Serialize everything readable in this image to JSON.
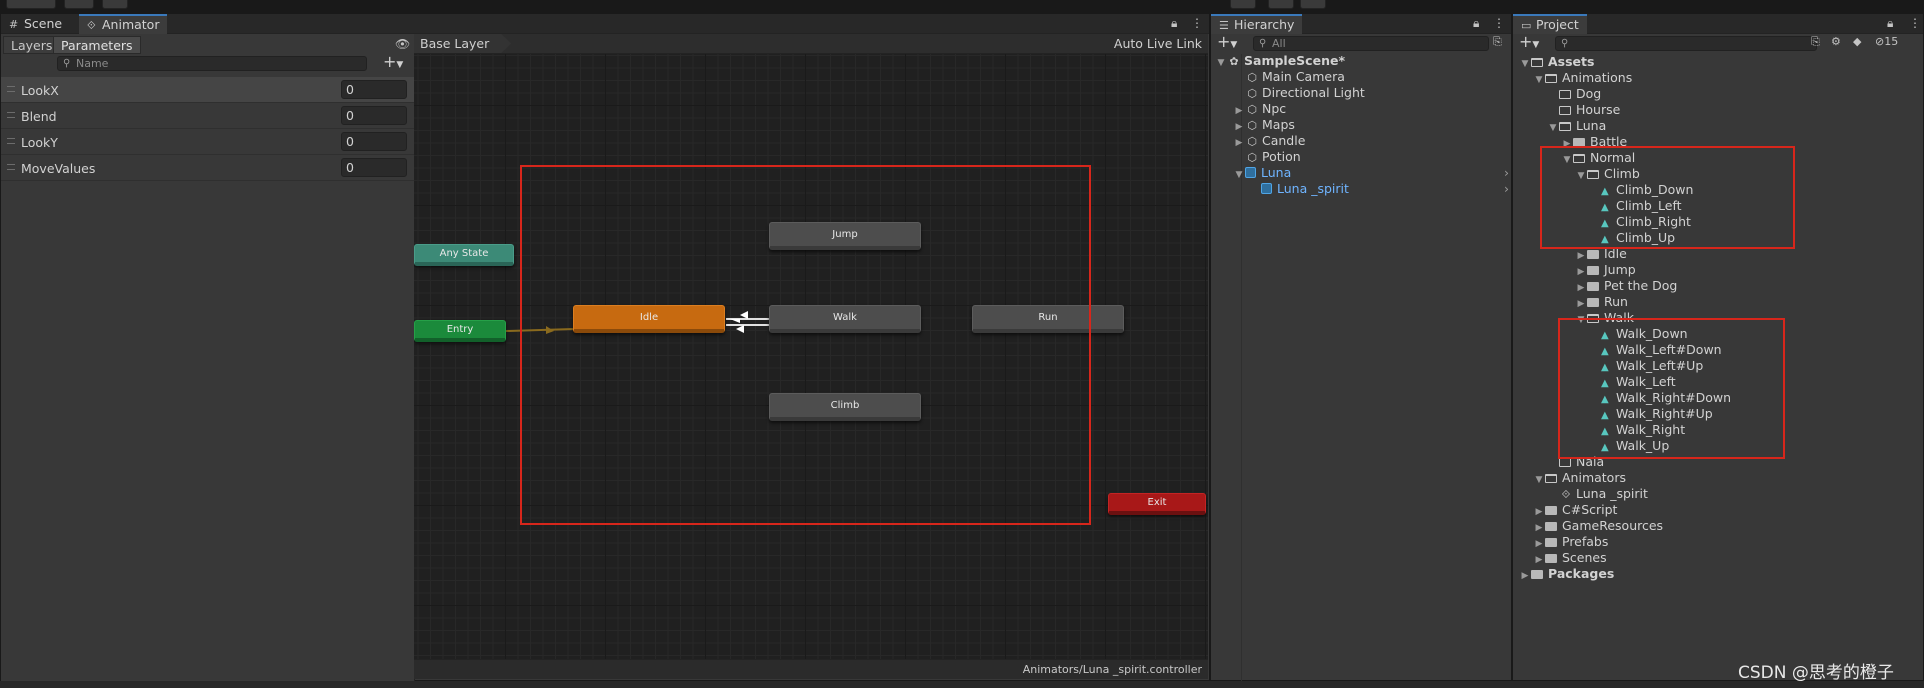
{
  "animator_window": {
    "tabs": [
      {
        "label": "Scene",
        "icon": "grid-icon"
      },
      {
        "label": "Animator",
        "icon": "animator-icon"
      }
    ],
    "left_pane": {
      "segments": [
        "Layers",
        "Parameters"
      ],
      "active_segment": "Parameters",
      "search_placeholder": "Name",
      "add_symbol": "+",
      "parameters": [
        {
          "name": "LookX",
          "value": "0"
        },
        {
          "name": "Blend",
          "value": "0"
        },
        {
          "name": "LookY",
          "value": "0"
        },
        {
          "name": "MoveValues",
          "value": "0"
        }
      ]
    },
    "graph": {
      "breadcrumb": "Base Layer",
      "live_link_label": "Auto Live Link",
      "states": {
        "any_state": "Any State",
        "entry": "Entry",
        "idle": "Idle",
        "jump": "Jump",
        "walk": "Walk",
        "run": "Run",
        "climb": "Climb",
        "exit": "Exit"
      },
      "status_path": "Animators/Luna _spirit.controller"
    }
  },
  "hierarchy_window": {
    "tab_label": "Hierarchy",
    "search_placeholder": "All",
    "scene_name": "SampleScene*",
    "items": [
      {
        "label": "Main Camera",
        "icon": "gameobject-icon",
        "expandable": false
      },
      {
        "label": "Directional Light",
        "icon": "gameobject-icon",
        "expandable": false
      },
      {
        "label": "Npc",
        "icon": "gameobject-icon",
        "expandable": true
      },
      {
        "label": "Maps",
        "icon": "gameobject-icon",
        "expandable": true
      },
      {
        "label": "Candle",
        "icon": "gameobject-icon",
        "expandable": true
      },
      {
        "label": "Potion",
        "icon": "gameobject-icon",
        "expandable": false
      },
      {
        "label": "Luna",
        "icon": "prefab-icon",
        "expandable": true,
        "expanded": true
      },
      {
        "label": "Luna _spirit",
        "icon": "prefab-icon",
        "expandable": false
      }
    ]
  },
  "project_window": {
    "tab_label": "Project",
    "hidden_count": "15",
    "tree": [
      {
        "label": "Assets",
        "bold": true
      },
      {
        "label": "Animations"
      },
      {
        "label": "Dog"
      },
      {
        "label": "Hourse"
      },
      {
        "label": "Luna"
      },
      {
        "label": "Battle"
      },
      {
        "label": "Normal"
      },
      {
        "label": "Climb"
      },
      {
        "label": "Climb_Down"
      },
      {
        "label": "Climb_Left"
      },
      {
        "label": "Climb_Right"
      },
      {
        "label": "Climb_Up"
      },
      {
        "label": "Idle"
      },
      {
        "label": "Jump"
      },
      {
        "label": "Pet the Dog"
      },
      {
        "label": "Run"
      },
      {
        "label": "Walk"
      },
      {
        "label": "Walk_Down"
      },
      {
        "label": "Walk_Left#Down"
      },
      {
        "label": "Walk_Left#Up"
      },
      {
        "label": "Walk_Left"
      },
      {
        "label": "Walk_Right#Down"
      },
      {
        "label": "Walk_Right#Up"
      },
      {
        "label": "Walk_Right"
      },
      {
        "label": "Walk_Up"
      },
      {
        "label": "Nala"
      },
      {
        "label": "Animators"
      },
      {
        "label": "Luna _spirit"
      },
      {
        "label": "C#Script"
      },
      {
        "label": "GameResources"
      },
      {
        "label": "Prefabs"
      },
      {
        "label": "Scenes"
      },
      {
        "label": "Packages",
        "bold": true
      }
    ]
  },
  "watermark": "CSDN @思考的橙子",
  "colors": {
    "highlight_box": "#d7261b",
    "idle_state": "#c76a10",
    "entry_state": "#1b8a3b",
    "any_state": "#3c8a77",
    "exit_state": "#a81818",
    "selected_link": "#6fb4ff",
    "tab_accent": "#3a79bb"
  }
}
